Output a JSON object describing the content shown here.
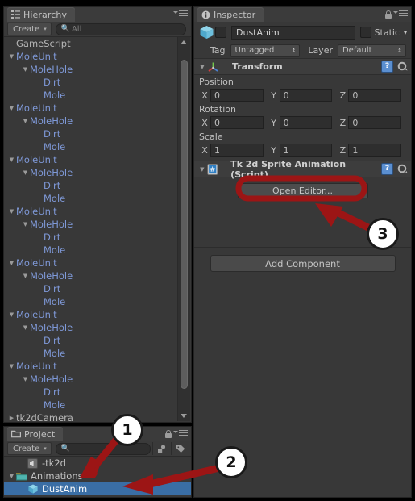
{
  "colors": {
    "panel_bg": "#383838",
    "prefab_blue": "#7f99d8",
    "selection_blue": "#3a6ea5",
    "annotation_red": "#9c1515",
    "accent_help_blue": "#5b8fd0"
  },
  "hierarchy": {
    "tab_label": "Hierarchy",
    "tab_icon": "hierarchy-icon",
    "create_label": "Create",
    "create_caret": "▾",
    "search_icon": "search-icon",
    "search_value": "",
    "search_placeholder": "All",
    "menu_icon": "panel-menu-icon",
    "items": [
      {
        "label": "GameScript",
        "indent": 0,
        "arrow": "",
        "prefab": false
      },
      {
        "label": "MoleUnit",
        "indent": 0,
        "arrow": "▼",
        "prefab": true
      },
      {
        "label": "MoleHole",
        "indent": 1,
        "arrow": "▼",
        "prefab": true
      },
      {
        "label": "Dirt",
        "indent": 2,
        "arrow": "",
        "prefab": true
      },
      {
        "label": "Mole",
        "indent": 2,
        "arrow": "",
        "prefab": true
      },
      {
        "label": "MoleUnit",
        "indent": 0,
        "arrow": "▼",
        "prefab": true
      },
      {
        "label": "MoleHole",
        "indent": 1,
        "arrow": "▼",
        "prefab": true
      },
      {
        "label": "Dirt",
        "indent": 2,
        "arrow": "",
        "prefab": true
      },
      {
        "label": "Mole",
        "indent": 2,
        "arrow": "",
        "prefab": true
      },
      {
        "label": "MoleUnit",
        "indent": 0,
        "arrow": "▼",
        "prefab": true
      },
      {
        "label": "MoleHole",
        "indent": 1,
        "arrow": "▼",
        "prefab": true
      },
      {
        "label": "Dirt",
        "indent": 2,
        "arrow": "",
        "prefab": true
      },
      {
        "label": "Mole",
        "indent": 2,
        "arrow": "",
        "prefab": true
      },
      {
        "label": "MoleUnit",
        "indent": 0,
        "arrow": "▼",
        "prefab": true
      },
      {
        "label": "MoleHole",
        "indent": 1,
        "arrow": "▼",
        "prefab": true
      },
      {
        "label": "Dirt",
        "indent": 2,
        "arrow": "",
        "prefab": true
      },
      {
        "label": "Mole",
        "indent": 2,
        "arrow": "",
        "prefab": true
      },
      {
        "label": "MoleUnit",
        "indent": 0,
        "arrow": "▼",
        "prefab": true
      },
      {
        "label": "MoleHole",
        "indent": 1,
        "arrow": "▼",
        "prefab": true
      },
      {
        "label": "Dirt",
        "indent": 2,
        "arrow": "",
        "prefab": true
      },
      {
        "label": "Mole",
        "indent": 2,
        "arrow": "",
        "prefab": true
      },
      {
        "label": "MoleUnit",
        "indent": 0,
        "arrow": "▼",
        "prefab": true
      },
      {
        "label": "MoleHole",
        "indent": 1,
        "arrow": "▼",
        "prefab": true
      },
      {
        "label": "Dirt",
        "indent": 2,
        "arrow": "",
        "prefab": true
      },
      {
        "label": "Mole",
        "indent": 2,
        "arrow": "",
        "prefab": true
      },
      {
        "label": "MoleUnit",
        "indent": 0,
        "arrow": "▼",
        "prefab": true
      },
      {
        "label": "MoleHole",
        "indent": 1,
        "arrow": "▼",
        "prefab": true
      },
      {
        "label": "Dirt",
        "indent": 2,
        "arrow": "",
        "prefab": true
      },
      {
        "label": "Mole",
        "indent": 2,
        "arrow": "",
        "prefab": true
      },
      {
        "label": "tk2dCamera",
        "indent": 0,
        "arrow": "▶",
        "prefab": false
      }
    ]
  },
  "project": {
    "tab_label": "Project",
    "tab_icon": "folder-icon",
    "create_label": "Create",
    "create_caret": "▾",
    "search_icon": "search-icon",
    "search_value": "",
    "lock_icon": "lock-icon",
    "menu_icon": "panel-menu-icon",
    "filter_icons": [
      "object-filter-icon",
      "label-filter-icon"
    ],
    "items": [
      {
        "label": "-tk2d",
        "indent": 1,
        "arrow": "",
        "icon": "audio-asset-icon",
        "selected": false
      },
      {
        "label": "Animations",
        "indent": 0,
        "arrow": "▼",
        "icon": "folder-icon",
        "selected": false
      },
      {
        "label": "DustAnim",
        "indent": 1,
        "arrow": "",
        "icon": "prefab-cube-icon",
        "selected": true
      }
    ]
  },
  "inspector": {
    "tab_label": "Inspector",
    "tab_icon": "info-icon",
    "lock_icon": "lock-icon",
    "menu_icon": "panel-menu-icon",
    "object_icon": "prefab-cube-icon",
    "active_checkbox_checked": false,
    "object_name": "DustAnim",
    "static_label": "Static",
    "static_checked": false,
    "static_caret": "▾",
    "tag_label": "Tag",
    "tag_value": "Untagged",
    "layer_label": "Layer",
    "layer_value": "Default",
    "components": [
      {
        "title": "Transform",
        "icon": "transform-gizmo-icon",
        "arrow": "▼",
        "help_icon": "help-icon",
        "gear_icon": "gear-icon",
        "vectors": [
          {
            "label": "Position",
            "x": "0",
            "y": "0",
            "z": "0"
          },
          {
            "label": "Rotation",
            "x": "0",
            "y": "0",
            "z": "0"
          },
          {
            "label": "Scale",
            "x": "1",
            "y": "1",
            "z": "1"
          }
        ]
      },
      {
        "title": "Tk 2d Sprite Animation (Script)",
        "icon": "csharp-script-icon",
        "arrow": "▼",
        "help_icon": "help-icon",
        "gear_icon": "gear-icon",
        "button_label": "Open Editor..."
      }
    ],
    "add_component_label": "Add Component"
  },
  "annotations": {
    "callouts": [
      {
        "number": "1",
        "target": "project-item-animations"
      },
      {
        "number": "2",
        "target": "project-item-dustanim"
      },
      {
        "number": "3",
        "target": "open-editor-button"
      }
    ],
    "highlight_shape": "rounded-rect-around-open-editor"
  }
}
